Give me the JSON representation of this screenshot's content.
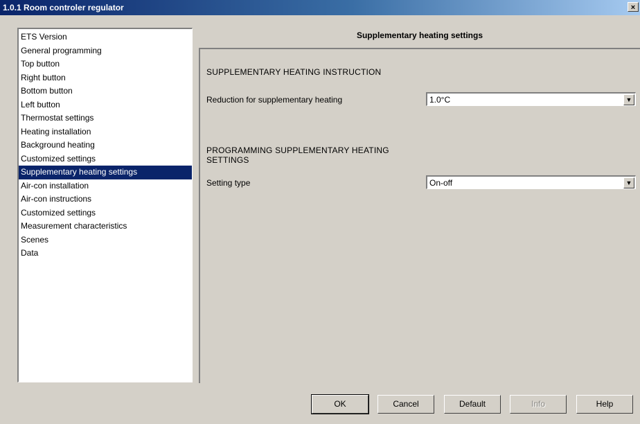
{
  "window": {
    "title": "1.0.1 Room controler regulator",
    "close_glyph": "×"
  },
  "nav": {
    "items": [
      {
        "label": "ETS Version"
      },
      {
        "label": "General programming"
      },
      {
        "label": "Top button"
      },
      {
        "label": "Right button"
      },
      {
        "label": "Bottom button"
      },
      {
        "label": "Left button"
      },
      {
        "label": "Thermostat settings"
      },
      {
        "label": "Heating installation"
      },
      {
        "label": "Background heating"
      },
      {
        "label": "Customized settings"
      },
      {
        "label": "Supplementary heating settings",
        "selected": true
      },
      {
        "label": "Air-con installation"
      },
      {
        "label": "Air-con instructions"
      },
      {
        "label": "Customized settings"
      },
      {
        "label": "Measurement characteristics"
      },
      {
        "label": "Scenes"
      },
      {
        "label": "Data"
      }
    ]
  },
  "panel": {
    "title": "Supplementary heating settings",
    "section1_heading": "SUPPLEMENTARY HEATING INSTRUCTION",
    "reduction_label": "Reduction for supplementary heating",
    "reduction_value": "1.0°C",
    "section2_heading": "PROGRAMMING SUPPLEMENTARY HEATING SETTINGS",
    "setting_type_label": "Setting type",
    "setting_type_value": "On-off",
    "dropdown_arrow": "▼"
  },
  "buttons": {
    "ok": "OK",
    "cancel": "Cancel",
    "default": "Default",
    "info": "Info",
    "help": "Help"
  },
  "colors": {
    "selection": "#0a246a",
    "face": "#d4d0c8"
  }
}
